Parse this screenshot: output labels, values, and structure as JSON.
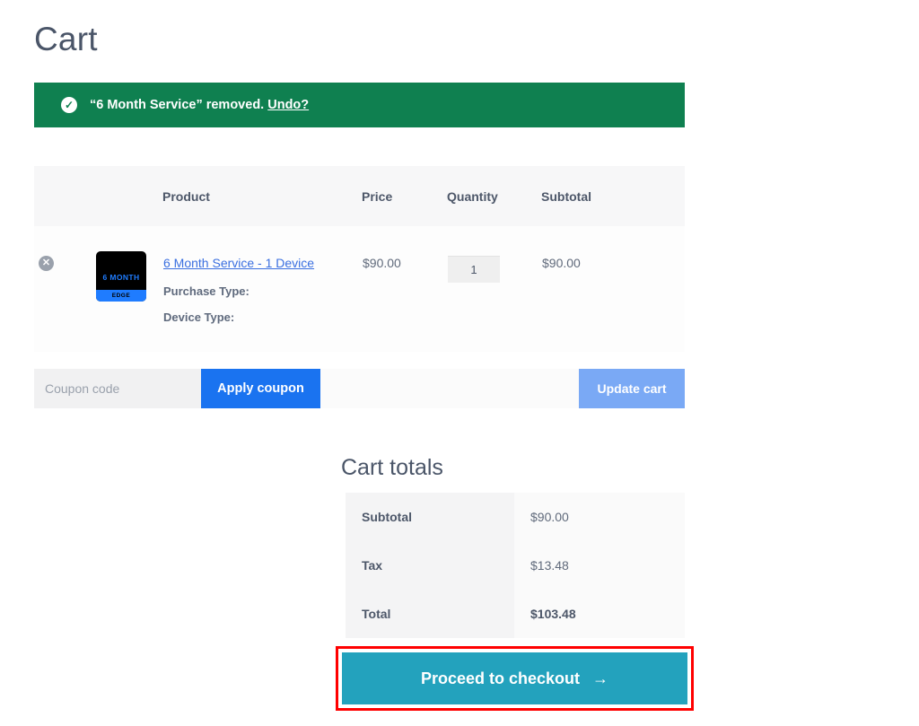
{
  "page": {
    "title": "Cart"
  },
  "notice": {
    "icon": "check-circle-icon",
    "message": "“6 Month Service” removed.",
    "undo_label": "Undo?",
    "background_color": "#0f8050"
  },
  "cart_table": {
    "headers": {
      "remove": "",
      "thumbnail": "",
      "product": "Product",
      "price": "Price",
      "quantity": "Quantity",
      "subtotal": "Subtotal"
    },
    "rows": [
      {
        "remove_icon": "remove-item-icon",
        "thumbnail": {
          "main_text": "6 MONTH",
          "bar_text": "EDGE",
          "background_color": "#000000",
          "accent_color": "#1f7cff"
        },
        "product_name": "6 Month Service - 1 Device",
        "meta": [
          "Purchase Type:",
          "Device Type:"
        ],
        "price": "$90.00",
        "quantity": "1",
        "subtotal": "$90.00"
      }
    ]
  },
  "coupon": {
    "placeholder": "Coupon code",
    "value": "",
    "apply_label": "Apply coupon",
    "apply_color": "#1a73f0",
    "update_label": "Update cart",
    "update_color": "#7aa9f5"
  },
  "totals": {
    "title": "Cart totals",
    "rows": [
      {
        "label": "Subtotal",
        "value": "$90.00"
      },
      {
        "label": "Tax",
        "value": "$13.48"
      },
      {
        "label": "Total",
        "value": "$103.48"
      }
    ]
  },
  "checkout": {
    "label": "Proceed to checkout",
    "arrow": "→",
    "button_color": "#23a2bd",
    "highlight_color": "#ff0000"
  }
}
